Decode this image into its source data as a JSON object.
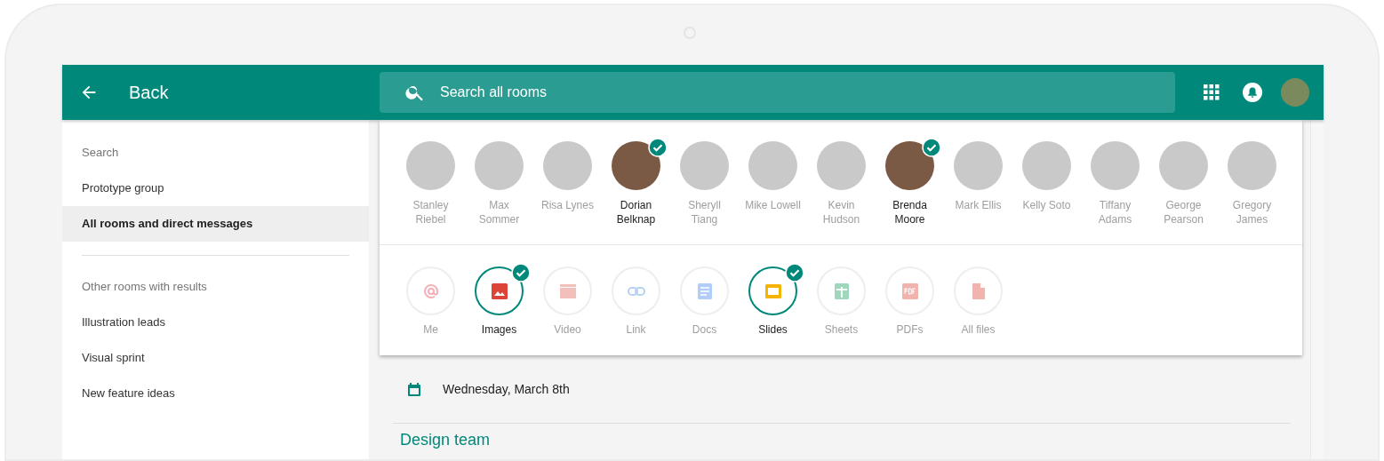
{
  "top_bar": {
    "back_label": "Back",
    "search": {
      "placeholder": "Search all rooms"
    }
  },
  "sidebar": {
    "sections": [
      {
        "header": "Search",
        "items": [
          {
            "label": "Prototype group",
            "selected": false
          },
          {
            "label": "All rooms and direct messages",
            "selected": true
          }
        ]
      },
      {
        "header": "Other rooms with results",
        "items": [
          {
            "label": "Illustration leads",
            "selected": false
          },
          {
            "label": "Visual sprint",
            "selected": false
          },
          {
            "label": "New feature ideas",
            "selected": false
          }
        ]
      }
    ]
  },
  "people": [
    {
      "name": "Stanley Riebel",
      "selected": false
    },
    {
      "name": "Max Sommer",
      "selected": false
    },
    {
      "name": "Risa Lynes",
      "selected": false
    },
    {
      "name": "Dorian Belknap",
      "selected": true
    },
    {
      "name": "Sheryll Tiang",
      "selected": false
    },
    {
      "name": "Mike Lowell",
      "selected": false
    },
    {
      "name": "Kevin Hudson",
      "selected": false
    },
    {
      "name": "Brenda Moore",
      "selected": true
    },
    {
      "name": "Mark Ellis",
      "selected": false
    },
    {
      "name": "Kelly Soto",
      "selected": false
    },
    {
      "name": "Tiffany Adams",
      "selected": false
    },
    {
      "name": "George Pearson",
      "selected": false
    },
    {
      "name": "Gregory James",
      "selected": false
    }
  ],
  "filters": [
    {
      "kind": "mention",
      "label": "Me",
      "selected": false
    },
    {
      "kind": "image",
      "label": "Images",
      "selected": true
    },
    {
      "kind": "video",
      "label": "Video",
      "selected": false
    },
    {
      "kind": "link",
      "label": "Link",
      "selected": false
    },
    {
      "kind": "doc",
      "label": "Docs",
      "selected": false
    },
    {
      "kind": "slides",
      "label": "Slides",
      "selected": true
    },
    {
      "kind": "sheet",
      "label": "Sheets",
      "selected": false
    },
    {
      "kind": "pdf",
      "label": "PDFs",
      "selected": false
    },
    {
      "kind": "file",
      "label": "All files",
      "selected": false
    }
  ],
  "date": "Wednesday, March 8th",
  "section_title": "Design team"
}
